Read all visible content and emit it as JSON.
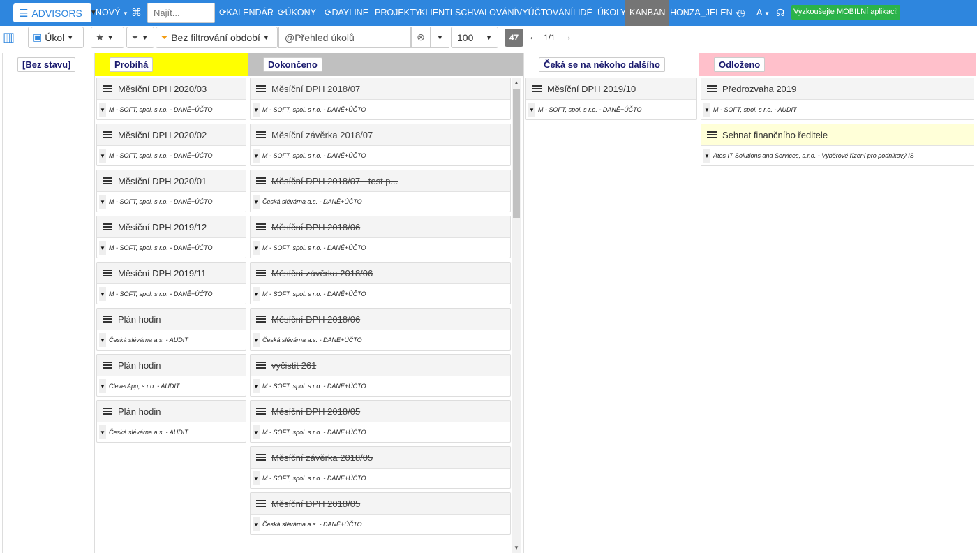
{
  "topbar": {
    "brand": "ADVISORS",
    "new_label": "NOVÝ",
    "search_placeholder": "Najít...",
    "nav": {
      "calendar": "KALENDÁŘ",
      "tasks_acts": "ÚKONY",
      "dayline": "DAYLINE",
      "projects": "PROJEKTY",
      "clients": "KLIENTI",
      "approval": "SCHVALOVÁNÍ",
      "billing": "VYÚČTOVÁNÍ",
      "people": "LIDÉ",
      "tasks": "ÚKOLY",
      "kanban": "KANBAN",
      "user": "HONZA_JELEN",
      "lang": "A"
    },
    "promo": "Vyzkoušejte MOBILNÍ aplikaci!",
    "accent": "#2e86de",
    "promo_color": "#2bb34a"
  },
  "toolbar": {
    "type_label": "Úkol",
    "period_label": "Bez filtrování období",
    "view_value": "@Přehled úkolů",
    "page_size": "100",
    "count": "47",
    "pagination": "1/1"
  },
  "columns": [
    {
      "title": "[Bez stavu]",
      "color": "#ffffff",
      "cards": []
    },
    {
      "title": "Probíhá",
      "color": "#ffff00",
      "cards": [
        {
          "title": "Měsíční DPH 2020/03",
          "sub": "M - SOFT, spol. s r.o. - DANĚ+ÚČTO"
        },
        {
          "title": "Měsíční DPH 2020/02",
          "sub": "M - SOFT, spol. s r.o. - DANĚ+ÚČTO"
        },
        {
          "title": "Měsíční DPH 2020/01",
          "sub": "M - SOFT, spol. s r.o. - DANĚ+ÚČTO"
        },
        {
          "title": "Měsíční DPH 2019/12",
          "sub": "M - SOFT, spol. s r.o. - DANĚ+ÚČTO"
        },
        {
          "title": "Měsíční DPH 2019/11",
          "sub": "M - SOFT, spol. s r.o. - DANĚ+ÚČTO"
        },
        {
          "title": "Plán hodin",
          "sub": "Česká slévárna a.s. - AUDIT"
        },
        {
          "title": "Plán hodin",
          "sub": "CleverApp, s.r.o. - AUDIT"
        },
        {
          "title": "Plán hodin",
          "sub": "Česká slévárna a.s. - AUDIT"
        }
      ]
    },
    {
      "title": "Dokončeno",
      "color": "#c0c0c0",
      "cards": [
        {
          "title": "Měsíční DPH 2018/07",
          "sub": "M - SOFT, spol. s r.o. - DANĚ+ÚČTO"
        },
        {
          "title": "Měsíční závěrka 2018/07",
          "sub": "M - SOFT, spol. s r.o. - DANĚ+ÚČTO"
        },
        {
          "title": "Měsíční DPH 2018/07 - test p...",
          "sub": "Česká slévárna a.s. - DANĚ+ÚČTO"
        },
        {
          "title": "Měsíční DPH 2018/06",
          "sub": "M - SOFT, spol. s r.o. - DANĚ+ÚČTO"
        },
        {
          "title": "Měsíční závěrka 2018/06",
          "sub": "M - SOFT, spol. s r.o. - DANĚ+ÚČTO"
        },
        {
          "title": "Měsíční DPH 2018/06",
          "sub": "Česká slévárna a.s. - DANĚ+ÚČTO"
        },
        {
          "title": "vyčistit 261",
          "sub": "M - SOFT, spol. s r.o. - DANĚ+ÚČTO"
        },
        {
          "title": "Měsíční DPH 2018/05",
          "sub": "M - SOFT, spol. s r.o. - DANĚ+ÚČTO"
        },
        {
          "title": "Měsíční závěrka 2018/05",
          "sub": "M - SOFT, spol. s r.o. - DANĚ+ÚČTO"
        },
        {
          "title": "Měsíční DPH 2018/05",
          "sub": "Česká slévárna a.s. - DANĚ+ÚČTO"
        }
      ]
    },
    {
      "title": "Čeká se na někoho dalšího",
      "color": "#ffffff",
      "cards": [
        {
          "title": "Měsíční DPH 2019/10",
          "sub": "M - SOFT, spol. s r.o. - DANĚ+ÚČTO"
        }
      ]
    },
    {
      "title": "Odloženo",
      "color": "#ffc0cb",
      "cards": [
        {
          "title": "Předrozvaha 2019",
          "sub": "M - SOFT, spol. s r.o. - AUDIT"
        },
        {
          "title": "Sehnat finančního ředitele",
          "sub": "Atos IT Solutions and Services, s.r.o. - Výběrové řízení pro podnikový IS"
        }
      ]
    }
  ]
}
